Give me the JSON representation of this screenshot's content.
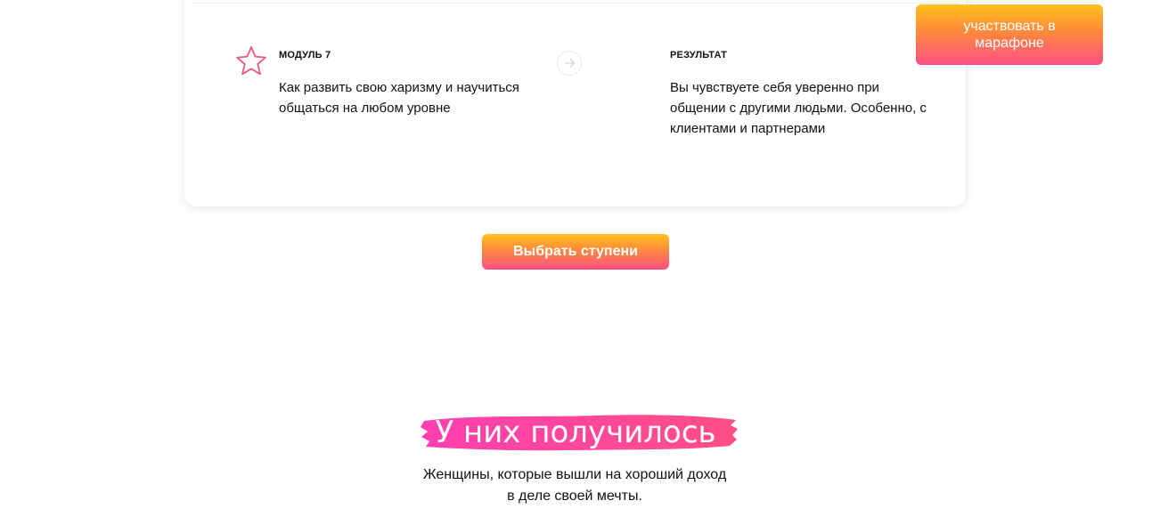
{
  "floating_cta": {
    "label": "участвовать в марафоне"
  },
  "module_card": {
    "module_label": "МОДУЛЬ 7",
    "module_text": "Как развить свою харизму и научиться общаться на любом уровне",
    "result_label": "РЕЗУЛЬТАТ",
    "result_text": "Вы чувствуете себя уверенно при общении с другими людьми. Особенно, с клиентами и партнерами",
    "icons": {
      "module": "star-icon",
      "transition": "arrow-right-icon"
    }
  },
  "choose_steps_button": {
    "label": "Выбрать ступени"
  },
  "success_section": {
    "title": "У них получилось",
    "subtitle_line1": "Женщины, которые вышли на хороший доход",
    "subtitle_line2": "в деле своей мечты."
  },
  "colors": {
    "gradient_top": "#ffc21a",
    "gradient_bottom": "#ff4f86",
    "brush_pink": "#ff3d8a",
    "star_outline": "#f0577a"
  }
}
